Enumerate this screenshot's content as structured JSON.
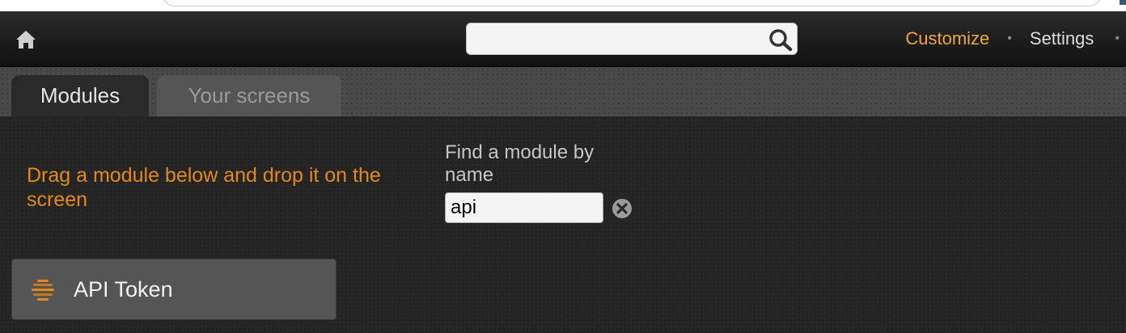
{
  "header": {
    "search": {
      "value": "",
      "placeholder": ""
    },
    "nav": {
      "customize": "Customize",
      "separator": "•",
      "settings": "Settings"
    }
  },
  "tabs": [
    {
      "label": "Modules",
      "active": true
    },
    {
      "label": "Your screens",
      "active": false
    }
  ],
  "modules_panel": {
    "instruction": "Drag a module below and drop it on the screen",
    "find_label": "Find a module by name",
    "find_value": "api",
    "results": [
      {
        "label": "API Token",
        "icon": "module-stack-icon"
      }
    ]
  },
  "colors": {
    "accent": "#f0a63b",
    "instruction": "#e48a17",
    "header_bg": "#1c1c1c",
    "content_bg": "#262626"
  }
}
